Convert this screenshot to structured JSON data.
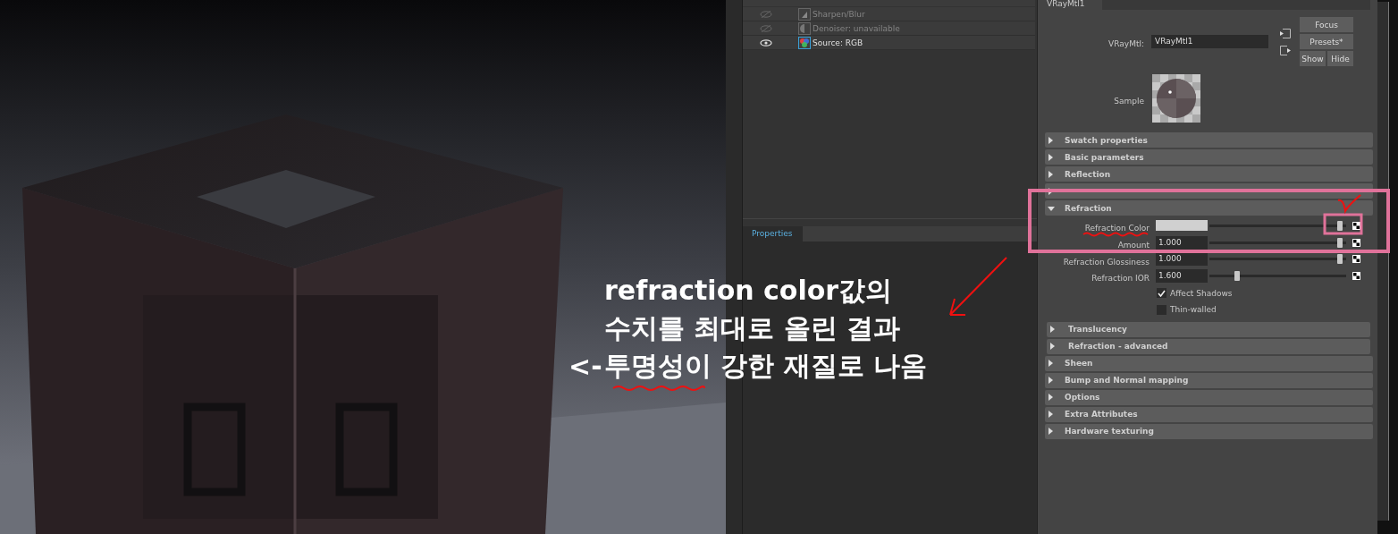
{
  "post_effects": {
    "items": [
      {
        "kind": "sharpen",
        "label": "Sharpen/Blur",
        "visible": false
      },
      {
        "kind": "denoiser",
        "label": "Denoiser: unavailable",
        "visible": false
      },
      {
        "kind": "source",
        "label": "Source: RGB",
        "visible": true
      }
    ]
  },
  "properties_panel": {
    "tab": "Properties"
  },
  "attribute_editor": {
    "tab": "VRayMtl1",
    "node_label": "VRayMtl:",
    "node_name": "VRayMtl1",
    "buttons": [
      "Focus",
      "Presets*"
    ],
    "toggle_buttons": [
      "Show",
      "Hide"
    ],
    "sample_label": "Sample",
    "sections": [
      {
        "title": "Swatch properties",
        "expanded": false
      },
      {
        "title": "Basic parameters",
        "expanded": false
      },
      {
        "title": "Reflection",
        "expanded": false
      },
      {
        "expanded": false
      },
      {
        "title": "Refraction",
        "expanded": true,
        "attributes": [
          {
            "kind": "color",
            "label": "Refraction Color",
            "level": 0.97
          },
          {
            "kind": "slider",
            "label": "Amount",
            "value": "1.000",
            "level": 0.97
          },
          {
            "kind": "slider",
            "label": "Refraction Glossiness",
            "value": "1.000",
            "level": 0.97
          },
          {
            "kind": "slider",
            "label": "Refraction IOR",
            "value": "1.600",
            "level": 0.19
          },
          {
            "kind": "checkbox",
            "label": "Affect Shadows",
            "checked": true
          },
          {
            "kind": "checkbox",
            "label": "Thin-walled",
            "checked": false
          }
        ],
        "subsections": [
          {
            "title": "Translucency",
            "expanded": false
          },
          {
            "title": "Refraction - advanced",
            "expanded": false
          }
        ]
      },
      {
        "title": "Sheen",
        "expanded": false
      },
      {
        "title": "Bump and Normal mapping",
        "expanded": false
      },
      {
        "title": "Options",
        "expanded": false
      },
      {
        "title": "Extra Attributes",
        "expanded": false
      },
      {
        "title": "Hardware texturing",
        "expanded": false
      }
    ]
  },
  "annotation": {
    "lines": [
      {
        "text": "refraction color값의"
      },
      {
        "text": "수치를 최대로 올린 결과"
      },
      {
        "prefix": "<-",
        "text": "투명성이 강한 재질로 나옴"
      }
    ]
  }
}
